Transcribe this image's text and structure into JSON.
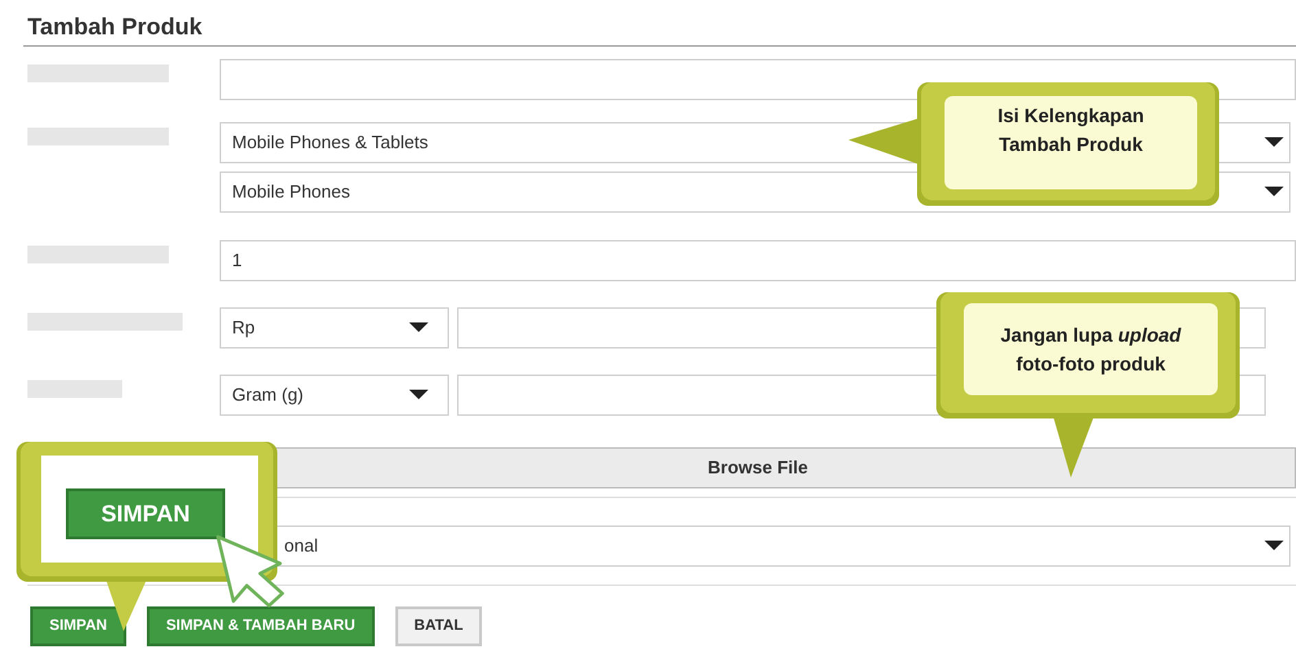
{
  "title": "Tambah Produk",
  "rows": [
    {
      "kind": "input"
    },
    {
      "kind": "select_pair",
      "values": [
        "Mobile Phones & Tablets",
        "Mobile Phones"
      ]
    },
    {
      "kind": "input",
      "value": "1"
    },
    {
      "kind": "unit_input",
      "unit": "Rp"
    },
    {
      "kind": "unit_input",
      "unit": "Gram (g)"
    }
  ],
  "browse_button": "Browse File",
  "condition_select": {
    "value": "onal"
  },
  "buttons": [
    {
      "label": "SIMPAN",
      "kind": "primary"
    },
    {
      "label": "SIMPAN & TAMBAH BARU",
      "kind": "primary"
    },
    {
      "label": "BATAL",
      "kind": "secondary"
    }
  ],
  "callouts": [
    {
      "kind": "note",
      "text": "Isi Kelengkapan Tambah Produk"
    },
    {
      "kind": "note",
      "text": "Jangan lupa *upload* foto-foto produk"
    },
    {
      "kind": "zoom",
      "button": "SIMPAN"
    }
  ]
}
